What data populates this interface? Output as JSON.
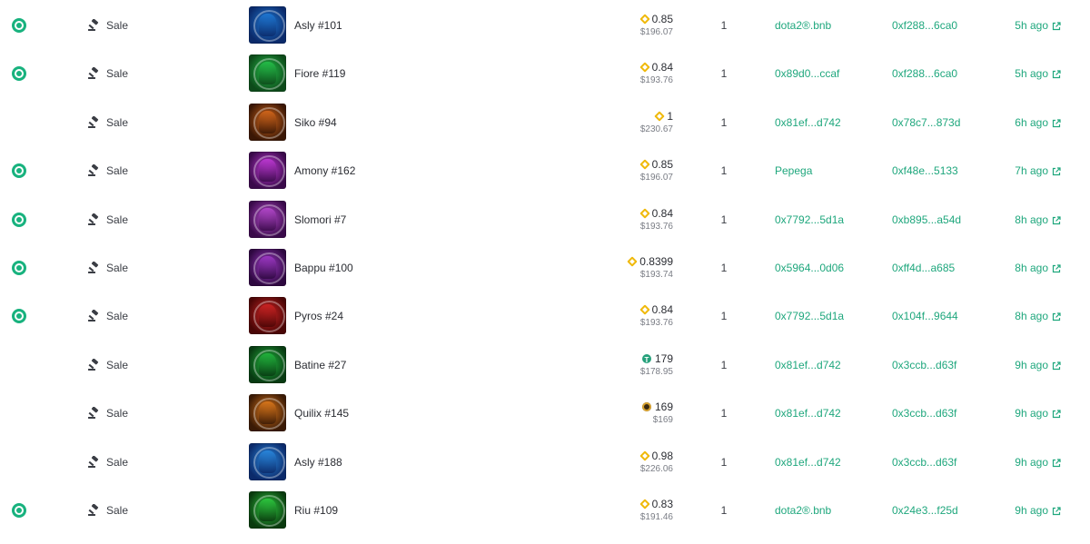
{
  "colors": {
    "link": "#1fa77d",
    "marker": "#18b27e",
    "bnb": "#f0b90b",
    "usdt": "#26a17b"
  },
  "rows": [
    {
      "marker": true,
      "event": "Sale",
      "name": "Asly #101",
      "thumb": [
        "#0b2a6a",
        "#1f7ad6"
      ],
      "price": "0.85",
      "coin": "bnb",
      "usd": "$196.07",
      "qty": "1",
      "from": "dota2®.bnb",
      "to": "0xf288...6ca0",
      "time": "5h ago"
    },
    {
      "marker": true,
      "event": "Sale",
      "name": "Fiore #119",
      "thumb": [
        "#0d4a1a",
        "#25c24a"
      ],
      "price": "0.84",
      "coin": "bnb",
      "usd": "$193.76",
      "qty": "1",
      "from": "0x89d0...ccaf",
      "to": "0xf288...6ca0",
      "time": "5h ago"
    },
    {
      "marker": false,
      "event": "Sale",
      "name": "Siko #94",
      "thumb": [
        "#3a1705",
        "#d8691c"
      ],
      "price": "1",
      "coin": "bnb",
      "usd": "$230.67",
      "qty": "1",
      "from": "0x81ef...d742",
      "to": "0x78c7...873d",
      "time": "6h ago"
    },
    {
      "marker": true,
      "event": "Sale",
      "name": "Amony #162",
      "thumb": [
        "#3a0a4a",
        "#c23ad8"
      ],
      "price": "0.85",
      "coin": "bnb",
      "usd": "$196.07",
      "qty": "1",
      "from": "Pepega",
      "to": "0xf48e...5133",
      "time": "7h ago"
    },
    {
      "marker": true,
      "event": "Sale",
      "name": "Slomori #7",
      "thumb": [
        "#3a0a4a",
        "#b84ad0"
      ],
      "price": "0.84",
      "coin": "bnb",
      "usd": "$193.76",
      "qty": "1",
      "from": "0x7792...5d1a",
      "to": "0xb895...a54d",
      "time": "8h ago"
    },
    {
      "marker": true,
      "event": "Sale",
      "name": "Bappu #100",
      "thumb": [
        "#2e0840",
        "#a03ac8"
      ],
      "price": "0.8399",
      "coin": "bnb",
      "usd": "$193.74",
      "qty": "1",
      "from": "0x5964...0d06",
      "to": "0xff4d...a685",
      "time": "8h ago"
    },
    {
      "marker": true,
      "event": "Sale",
      "name": "Pyros #24",
      "thumb": [
        "#4a0606",
        "#d02424"
      ],
      "price": "0.84",
      "coin": "bnb",
      "usd": "$193.76",
      "qty": "1",
      "from": "0x7792...5d1a",
      "to": "0x104f...9644",
      "time": "8h ago"
    },
    {
      "marker": false,
      "event": "Sale",
      "name": "Batine #27",
      "thumb": [
        "#083a12",
        "#22b83e"
      ],
      "price": "179",
      "coin": "usdt",
      "usd": "$178.95",
      "qty": "1",
      "from": "0x81ef...d742",
      "to": "0x3ccb...d63f",
      "time": "9h ago"
    },
    {
      "marker": false,
      "event": "Sale",
      "name": "Quilix #145",
      "thumb": [
        "#3a1a05",
        "#e07a1c"
      ],
      "price": "169",
      "coin": "dark",
      "usd": "$169",
      "qty": "1",
      "from": "0x81ef...d742",
      "to": "0x3ccb...d63f",
      "time": "9h ago"
    },
    {
      "marker": false,
      "event": "Sale",
      "name": "Asly #188",
      "thumb": [
        "#0b2a6a",
        "#2a8ae0"
      ],
      "price": "0.98",
      "coin": "bnb",
      "usd": "$226.06",
      "qty": "1",
      "from": "0x81ef...d742",
      "to": "0x3ccb...d63f",
      "time": "9h ago"
    },
    {
      "marker": true,
      "event": "Sale",
      "name": "Riu #109",
      "thumb": [
        "#0a3a0e",
        "#2ecc40"
      ],
      "price": "0.83",
      "coin": "bnb",
      "usd": "$191.46",
      "qty": "1",
      "from": "dota2®.bnb",
      "to": "0x24e3...f25d",
      "time": "9h ago"
    }
  ]
}
